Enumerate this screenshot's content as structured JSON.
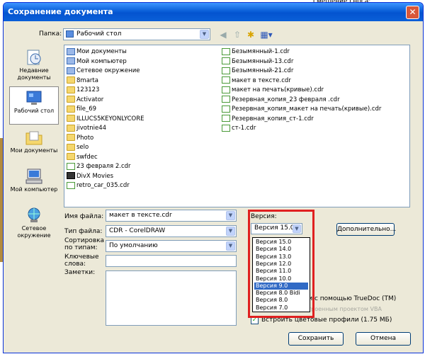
{
  "background": {
    "top_right_text": "смещение сноса:"
  },
  "window": {
    "title": "Сохранение документа",
    "close_glyph": "✕"
  },
  "folder_bar": {
    "label": "Папка:",
    "value": "Рабочий стол"
  },
  "places": [
    {
      "label": "Недавние документы",
      "icon": "recent-docs-icon"
    },
    {
      "label": "Рабочий стол",
      "icon": "desktop-icon",
      "selected": true
    },
    {
      "label": "Мои документы",
      "icon": "my-documents-icon"
    },
    {
      "label": "Мой компьютер",
      "icon": "my-computer-icon"
    },
    {
      "label": "Сетевое окружение",
      "icon": "network-icon"
    }
  ],
  "files_col1": [
    {
      "name": "Мои документы",
      "type": "sys"
    },
    {
      "name": "Мой компьютер",
      "type": "sys"
    },
    {
      "name": "Сетевое окружение",
      "type": "sys"
    },
    {
      "name": "8marta",
      "type": "folder"
    },
    {
      "name": "123123",
      "type": "folder"
    },
    {
      "name": "Activator",
      "type": "folder"
    },
    {
      "name": "file_69",
      "type": "folder"
    },
    {
      "name": "ILLUCS5KEYONLYCORE",
      "type": "folder"
    },
    {
      "name": "jivotnie44",
      "type": "folder"
    },
    {
      "name": "Photo",
      "type": "folder"
    },
    {
      "name": "selo",
      "type": "folder"
    },
    {
      "name": "swfdec",
      "type": "folder"
    },
    {
      "name": "23 февраля 2.cdr",
      "type": "cdr"
    },
    {
      "name": "DivX Movies",
      "type": "mov"
    },
    {
      "name": "retro_car_035.cdr",
      "type": "cdr"
    }
  ],
  "files_col2": [
    {
      "name": "Безымянный-1.cdr",
      "type": "cdr"
    },
    {
      "name": "Безымянный-13.cdr",
      "type": "cdr"
    },
    {
      "name": "Безымянный-21.cdr",
      "type": "cdr"
    },
    {
      "name": "макет в тексте.cdr",
      "type": "cdr"
    },
    {
      "name": "макет на печать(кривые).cdr",
      "type": "cdr"
    },
    {
      "name": "Резервная_копия_23 февраля .cdr",
      "type": "cdr"
    },
    {
      "name": "Резервная_копия_макет на печать(кривые).cdr",
      "type": "cdr"
    },
    {
      "name": "Резервная_копия_ст-1.cdr",
      "type": "cdr"
    },
    {
      "name": "ст-1.cdr",
      "type": "cdr"
    }
  ],
  "form": {
    "filename_label": "Имя файла:",
    "filename_value": "макет в тексте.cdr",
    "filetype_label": "Тип файла:",
    "filetype_value": "CDR - CorelDRAW",
    "sort_label": "Сортировка по типам:",
    "sort_value": "По умолчанию",
    "keywords_label": "Ключевые слова:",
    "notes_label": "Заметки:"
  },
  "version": {
    "label": "Версия:",
    "selected": "Версия 15.0",
    "options": [
      "Версия 15.0",
      "Версия 14.0",
      "Версия 13.0",
      "Версия 12.0",
      "Версия 11.0",
      "Версия 10.0",
      "Версия 9.0",
      "Версия 8.0 Bidi",
      "Версия 8.0",
      "Версия 7.0"
    ],
    "highlighted_index": 6
  },
  "advanced_button": "Дополнительно...",
  "options": {
    "truedoc_text": "ти с помощью TrueDoc (TM)",
    "vba_text": "Сохранить со встроенным проектом VBA",
    "embed_icc_label": "Встроить цветовые профили (1.75 МБ)",
    "embed_icc_checked": "✓"
  },
  "buttons": {
    "save": "Сохранить",
    "cancel": "Отмена"
  }
}
